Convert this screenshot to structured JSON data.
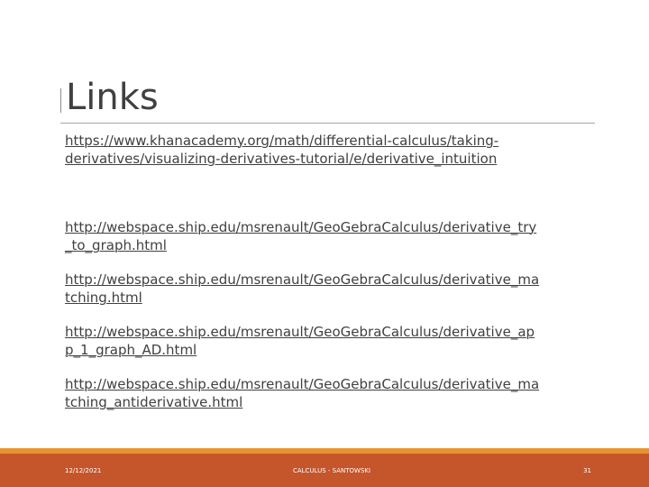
{
  "slide": {
    "title": "Links",
    "links": [
      {
        "lines": [
          "https://www.khanacademy.org/math/differential-calculus/taking-",
          "derivatives/visualizing-derivatives-tutorial/e/derivative_intuition"
        ]
      },
      {
        "lines": [
          "http://webspace.ship.edu/msrenault/GeoGebraCalculus/derivative_try",
          "_to_graph.html"
        ]
      },
      {
        "lines": [
          "http://webspace.ship.edu/msrenault/GeoGebraCalculus/derivative_ma",
          "tching.html"
        ]
      },
      {
        "lines": [
          "http://webspace.ship.edu/msrenault/GeoGebraCalculus/derivative_ap",
          "p_1_graph_AD.html"
        ]
      },
      {
        "lines": [
          "http://webspace.ship.edu/msrenault/GeoGebraCalculus/derivative_ma",
          "tching_antiderivative.html"
        ]
      }
    ],
    "footer": {
      "date": "12/12/2021",
      "center": "CALCULUS - SANTOWSKI",
      "page": "31"
    }
  },
  "colors": {
    "text": "#404040",
    "footer_orange": "#e9932f",
    "footer_red": "#c5552a"
  }
}
